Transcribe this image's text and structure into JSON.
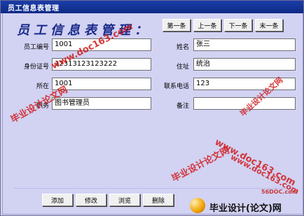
{
  "window": {
    "title": "员工信息表管理"
  },
  "header": {
    "title": "员工信息表管理："
  },
  "nav": {
    "first": "第一条",
    "prev": "上一条",
    "next": "下一条",
    "last": "末一条"
  },
  "form": {
    "labels": {
      "employee_id": "员工编号",
      "name": "姓名",
      "id_number": "身份证号",
      "address": "住址",
      "field3": "所在",
      "phone": "联系电话",
      "position": "职务",
      "note": "备注"
    },
    "values": {
      "employee_id": "1001",
      "name": "张三",
      "id_number": "12313123123222",
      "address": "统治",
      "field3": "1001",
      "phone": "123",
      "position": "图书管理员",
      "note": ""
    }
  },
  "actions": {
    "add": "添加",
    "edit": "修改",
    "browse": "浏览",
    "delete": "删除"
  },
  "watermarks": {
    "wm1": "www.doc163.com",
    "wm2": "毕业设计论文网",
    "wm3": "www.doc163.com",
    "wm4": "毕业设计论文网",
    "wm5": "www.doc163.com",
    "wm6": "毕业设计论文网",
    "site": "56DOC.com",
    "brand": "毕业设计(论文)网"
  },
  "colors": {
    "titlebar": "#1b3ea8",
    "client_bg": "#d2d2f3",
    "heading": "#1a2a8a",
    "watermark": "#d11a1a"
  }
}
